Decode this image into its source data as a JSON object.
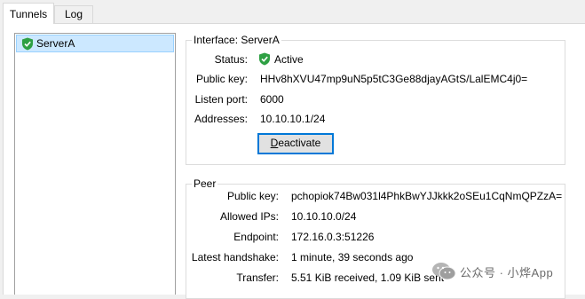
{
  "tabs": [
    {
      "label": "Tunnels",
      "active": true
    },
    {
      "label": "Log",
      "active": false
    }
  ],
  "tunnels": [
    {
      "name": "ServerA",
      "icon": "shield-check-icon",
      "selected": true
    }
  ],
  "interface": {
    "group_title": "Interface: ServerA",
    "status_label": "Status:",
    "status_value": "Active",
    "status_icon": "shield-check-icon",
    "public_key_label": "Public key:",
    "public_key_value": "HHv8hXVU47mp9uN5p5tC3Ge88djayAGtS/LalEMC4j0=",
    "listen_port_label": "Listen port:",
    "listen_port_value": "6000",
    "addresses_label": "Addresses:",
    "addresses_value": "10.10.10.1/24",
    "deactivate_first": "D",
    "deactivate_rest": "eactivate"
  },
  "peer": {
    "group_title": "Peer",
    "public_key_label": "Public key:",
    "public_key_value": "pchopiok74Bw031l4PhkBwYJJkkk2oSEu1CqNmQPZzA=",
    "allowed_ips_label": "Allowed IPs:",
    "allowed_ips_value": "10.10.10.0/24",
    "endpoint_label": "Endpoint:",
    "endpoint_value": "172.16.0.3:51226",
    "handshake_label": "Latest handshake:",
    "handshake_value": "1 minute, 39 seconds ago",
    "transfer_label": "Transfer:",
    "transfer_value": "5.51 KiB received, 1.09 KiB sent"
  },
  "watermark": {
    "text": "公众号 · 小烨App"
  },
  "colors": {
    "shield_green": "#2ea043",
    "selection_bg": "#cce8ff",
    "selection_border": "#99d1ff",
    "button_focus": "#0078d7"
  }
}
